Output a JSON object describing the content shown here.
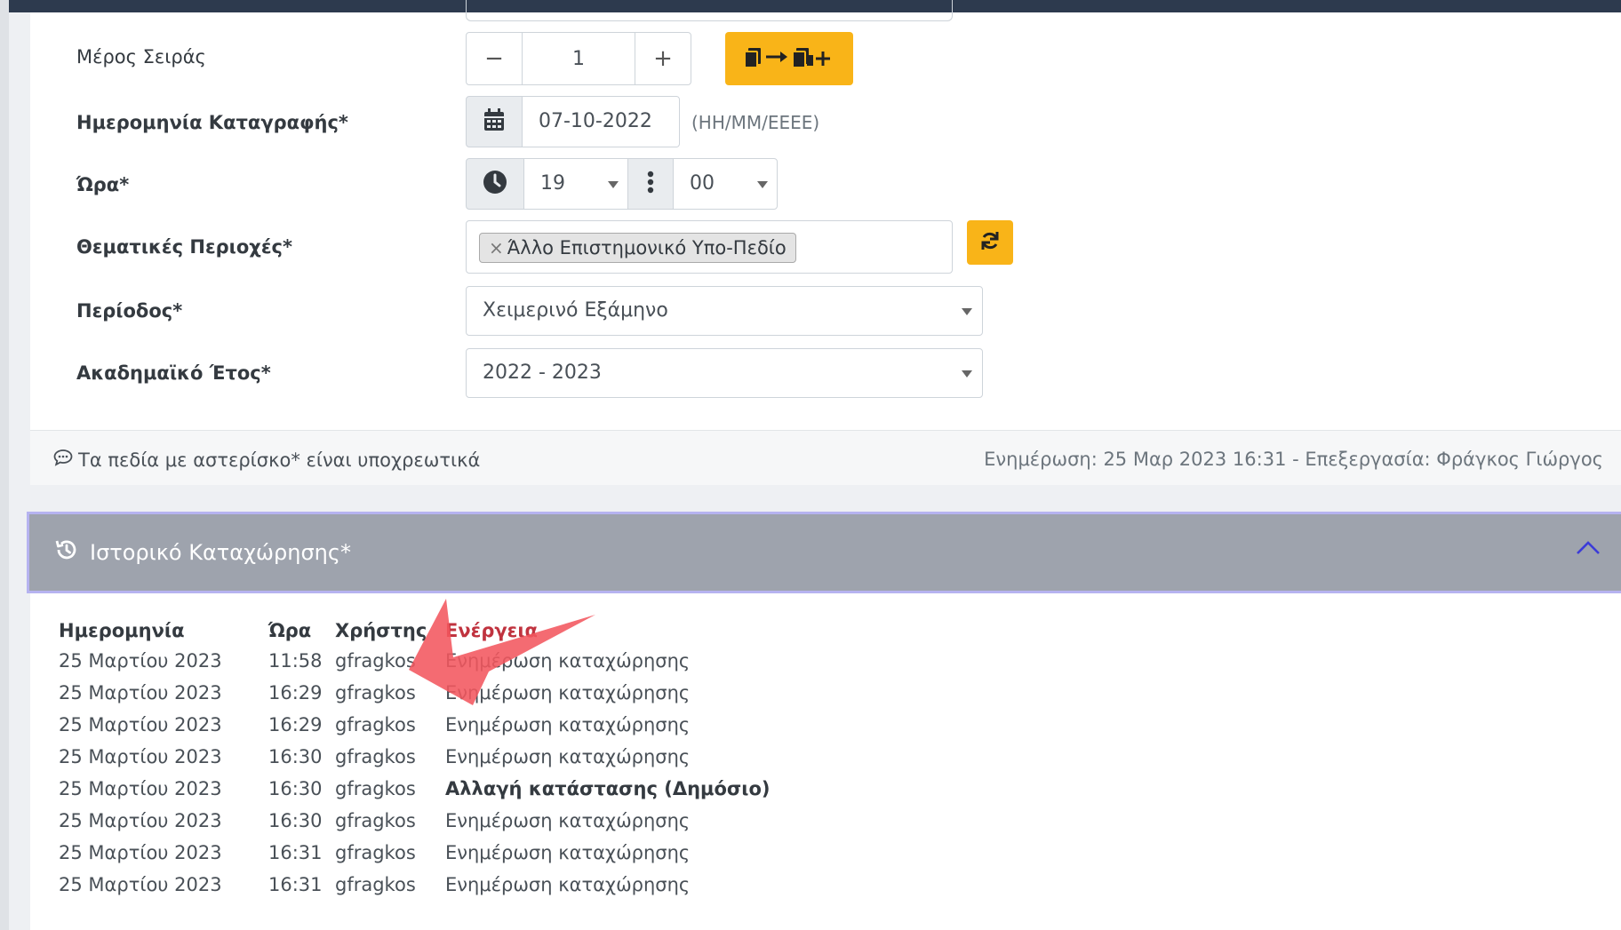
{
  "form": {
    "series_part": {
      "label": "Μέρος Σειράς",
      "minus": "−",
      "value": "1",
      "plus": "+"
    },
    "record_date": {
      "label": "Ημερομηνία Καταγραφής*",
      "value": "07-10-2022",
      "hint": "(ΗΗ/ΜΜ/ΕΕΕΕ)"
    },
    "time": {
      "label": "Ώρα*",
      "hour": "19",
      "minute": "00"
    },
    "subject_areas": {
      "label": "Θεματικές Περιοχές*",
      "tag_remove": "×",
      "tag": "Άλλο Επιστημονικό Υπο-Πεδίο"
    },
    "period": {
      "label": "Περίοδος*",
      "value": "Χειμερινό Εξάμηνο"
    },
    "academic_year": {
      "label": "Ακαδημαϊκό Έτος*",
      "value": "2022 - 2023"
    }
  },
  "footer": {
    "required_note": "Τα πεδία με αστερίσκο* είναι υποχρεωτικά",
    "update_info": "Ενημέρωση: 25 Μαρ 2023 16:31 - Επεξεργασία: Φράγκος Γιώργος"
  },
  "history": {
    "title": "Ιστορικό Καταχώρησης*",
    "columns": [
      "Ημερομηνία",
      "Ώρα",
      "Χρήστης",
      "Ενέργεια"
    ],
    "rows": [
      {
        "date": "25 Μαρτίου 2023",
        "time": "11:58",
        "user": "gfragkos",
        "action": "Ενημέρωση καταχώρησης"
      },
      {
        "date": "25 Μαρτίου 2023",
        "time": "16:29",
        "user": "gfragkos",
        "action": "Ενημέρωση καταχώρησης"
      },
      {
        "date": "25 Μαρτίου 2023",
        "time": "16:29",
        "user": "gfragkos",
        "action": "Ενημέρωση καταχώρησης"
      },
      {
        "date": "25 Μαρτίου 2023",
        "time": "16:30",
        "user": "gfragkos",
        "action": "Ενημέρωση καταχώρησης"
      },
      {
        "date": "25 Μαρτίου 2023",
        "time": "16:30",
        "user": "gfragkos",
        "action": "Αλλαγή κατάστασης (Δημόσιο)"
      },
      {
        "date": "25 Μαρτίου 2023",
        "time": "16:30",
        "user": "gfragkos",
        "action": "Ενημέρωση καταχώρησης"
      },
      {
        "date": "25 Μαρτίου 2023",
        "time": "16:31",
        "user": "gfragkos",
        "action": "Ενημέρωση καταχώρησης"
      },
      {
        "date": "25 Μαρτίου 2023",
        "time": "16:31",
        "user": "gfragkos",
        "action": "Ενημέρωση καταχώρησης"
      }
    ]
  },
  "colors": {
    "accent_orange": "#f9b418",
    "header_gray": "#9ea3ad",
    "arrow_red": "#f2565f"
  },
  "icons": {
    "copy": "copy-arrow-icon",
    "calendar": "calendar-icon",
    "clock": "clock-icon",
    "refresh": "refresh-icon",
    "comment": "comment-icon",
    "history": "history-icon",
    "collapse": "chevron-up-icon"
  }
}
